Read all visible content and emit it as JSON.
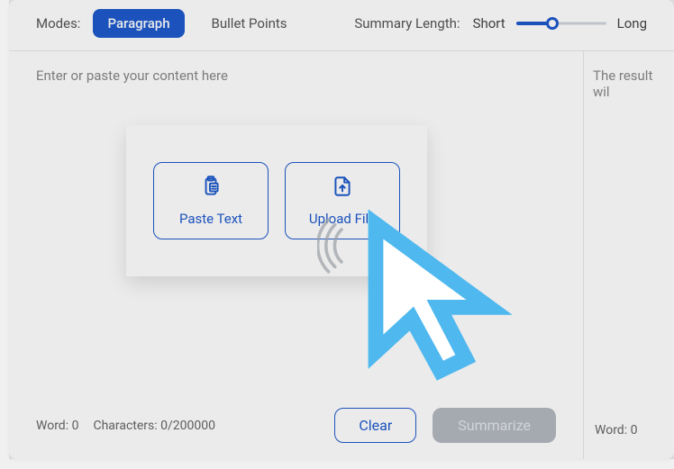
{
  "toolbar": {
    "modes_label": "Modes:",
    "mode_paragraph": "Paragraph",
    "mode_bullet": "Bullet Points",
    "summary_length_label": "Summary Length:",
    "short_label": "Short",
    "long_label": "Long"
  },
  "input": {
    "placeholder": "Enter or paste your content here",
    "paste_text_label": "Paste Text",
    "upload_file_label": "Upload File",
    "word_label": "Word:",
    "word_count": "0",
    "characters_label": "Characters:",
    "characters_count": "0/200000",
    "clear_label": "Clear",
    "summarize_label": "Summarize"
  },
  "output": {
    "placeholder": "The result wil",
    "word_label": "Word:",
    "word_count": "0"
  }
}
